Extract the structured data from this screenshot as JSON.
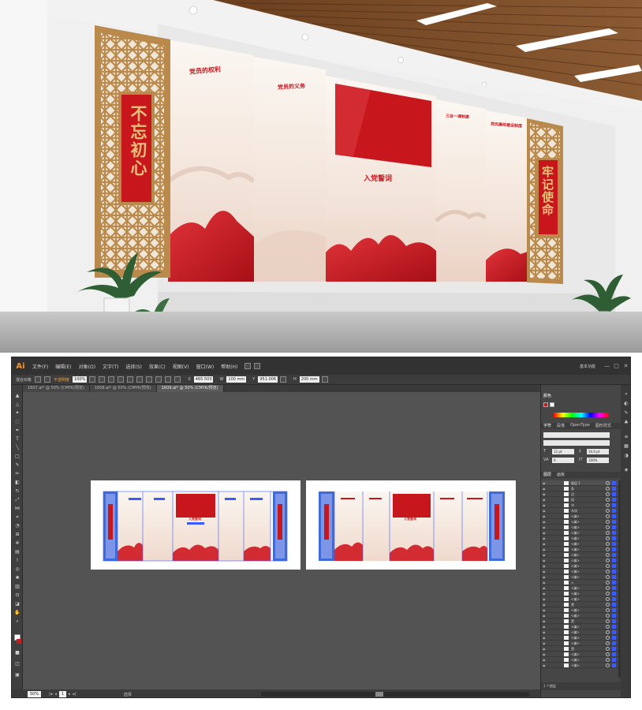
{
  "render": {
    "left_scroll_text": "不忘初心",
    "right_scroll_text": "牢记使命",
    "panel_titles": [
      "党员的权利",
      "党员的义务",
      "入党誓词",
      "三会一课制度",
      "党风廉政建设制度"
    ],
    "colors": {
      "party_red": "#c8161d",
      "gold": "#e8c07a",
      "wood": "#b98a4b"
    }
  },
  "app": {
    "logo": "Ai",
    "menus": [
      "文件(F)",
      "编辑(E)",
      "对象(O)",
      "文字(T)",
      "选择(S)",
      "效果(C)",
      "视图(V)",
      "窗口(W)",
      "帮助(H)"
    ],
    "workspace": "基本功能",
    "window_buttons": [
      "—",
      "□",
      "✕"
    ]
  },
  "control_bar": {
    "selection_label": "混合对象",
    "mode_label": "不透明度",
    "opacity": "100%",
    "x_value": "465.503",
    "w_value": "100 mm",
    "y_value": "951.006",
    "h_value": "200 mm"
  },
  "document_tabs": [
    {
      "label": "1607.ai* @ 50% (CMYK/预览)",
      "active": false
    },
    {
      "label": "1608.ai* @ 50% (CMYK/预览)",
      "active": false
    },
    {
      "label": "1609.ai* @ 50% (CMYK/预览)",
      "active": true
    }
  ],
  "canvas": {
    "artboard_titles": [
      "入党誓词",
      "入党誓词"
    ]
  },
  "status_bar": {
    "zoom": "50%",
    "page": "1",
    "status": "选择"
  },
  "panels": {
    "color_tab": "颜色",
    "character_tabs": [
      "字符",
      "段落",
      "OpenType",
      "图形样式"
    ],
    "character_fields": {
      "size": "12 pt",
      "leading": "14.4 pt",
      "tracking": "0",
      "scale": "100%"
    },
    "layers_tabs": [
      "图层",
      "画板"
    ],
    "top_layer": "图层 1",
    "layer_items": [
      "条",
      "边",
      "组",
      "书",
      "木纹",
      "<编>",
      "<编>",
      "<编>",
      "<编>",
      "<编>",
      "<编>",
      "<编>",
      "<编>",
      "<编>",
      "<编>",
      "<编>",
      "<编>",
      "入",
      "<编>",
      "<编>",
      "<编>",
      "贯",
      "<编>",
      "<编>",
      "贯",
      "<编>",
      "<编>",
      "<编>",
      "<编>",
      "贯",
      "<编>",
      "<编>",
      "<编>"
    ],
    "layers_footer": "1 个图层"
  }
}
